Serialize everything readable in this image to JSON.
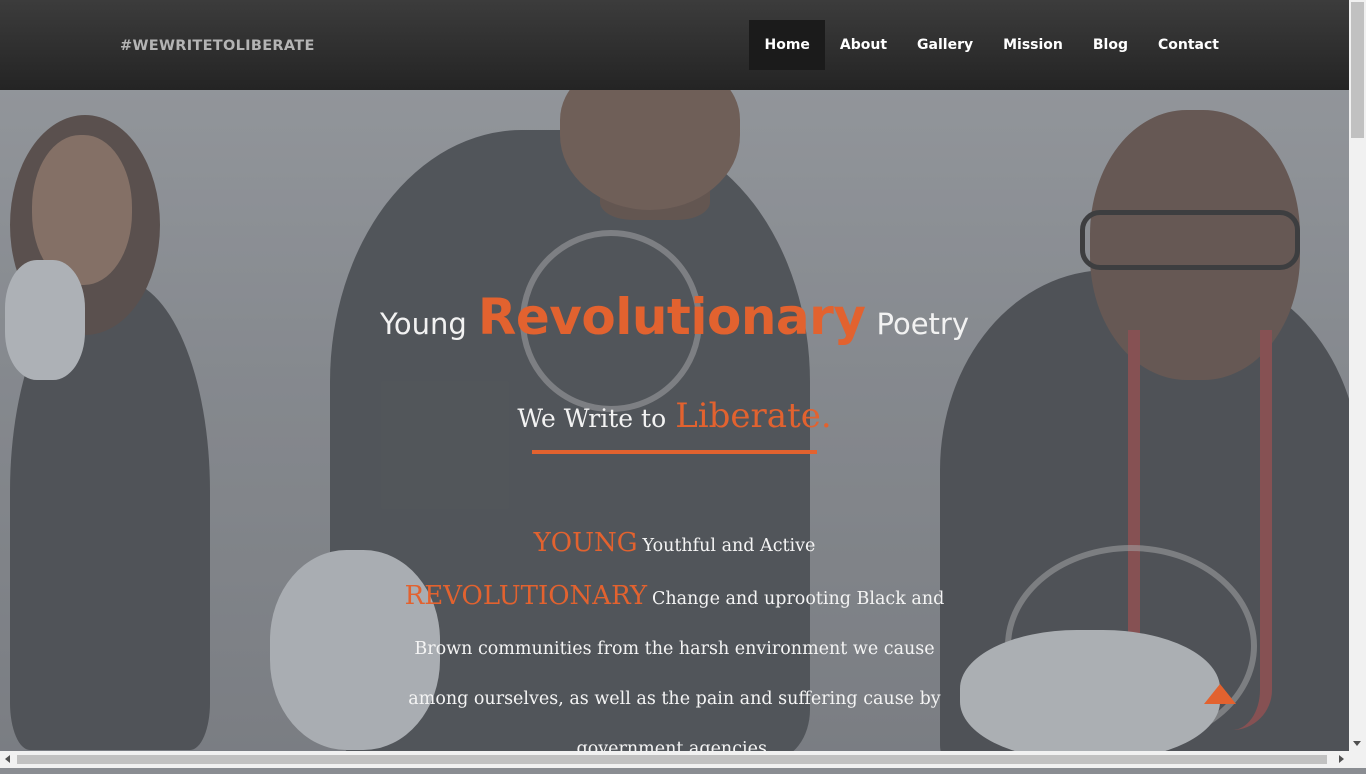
{
  "brand": "#WEWRITETOLIBERATE",
  "nav": {
    "items": [
      {
        "label": "Home"
      },
      {
        "label": "About"
      },
      {
        "label": "Gallery"
      },
      {
        "label": "Mission"
      },
      {
        "label": "Blog"
      },
      {
        "label": "Contact"
      }
    ],
    "active": "Home"
  },
  "hero": {
    "headline": {
      "before": "Young",
      "accent": "Revolutionary",
      "after": "Poetry"
    },
    "tagline": {
      "plain": "We Write to",
      "accent": "Liberate."
    },
    "definitions": [
      {
        "term": "YOUNG",
        "text": "Youthful and Active"
      },
      {
        "term": "REVOLUTIONARY",
        "text": "Change and uprooting Black and Brown communities from the harsh environment we cause among ourselves, as well as the pain and suffering cause by government agencies."
      }
    ]
  },
  "colors": {
    "accent": "#e2622f",
    "nav_bg": "#2d2d2d"
  },
  "icons": {
    "scroll_top": "triangle-up-icon"
  }
}
